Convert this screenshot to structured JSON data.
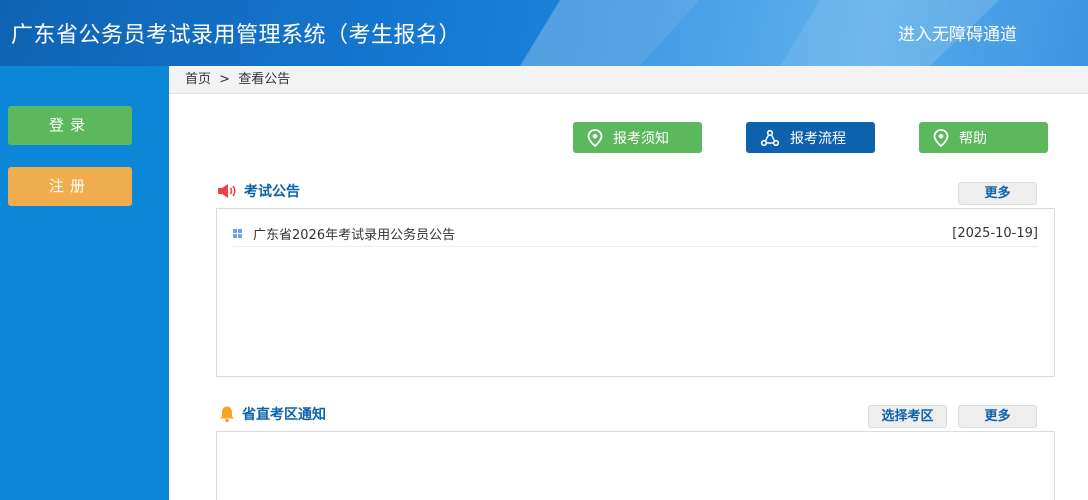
{
  "header": {
    "title": "广东省公务员考试录用管理系统（考生报名）",
    "accessibility_link": "进入无障碍通道"
  },
  "sidebar": {
    "login_label": "登录",
    "register_label": "注册"
  },
  "breadcrumb": {
    "home": "首页",
    "separator": ">",
    "current": "查看公告"
  },
  "actions": {
    "guide_label": "报考须知",
    "process_label": "报考流程",
    "help_label": "帮助"
  },
  "exam_notices": {
    "title": "考试公告",
    "more_label": "更多",
    "items": [
      {
        "title": "广东省2026年考试录用公务员公告",
        "date": "[2025-10-19]"
      }
    ]
  },
  "district_notices": {
    "title": "省直考区通知",
    "select_area_label": "选择考区",
    "more_label": "更多"
  },
  "colors": {
    "header_blue": "#1576cf",
    "sidebar_blue": "#0c86d6",
    "green": "#5cb85c",
    "orange": "#f0ad4e",
    "dark_blue": "#0c62ac"
  }
}
